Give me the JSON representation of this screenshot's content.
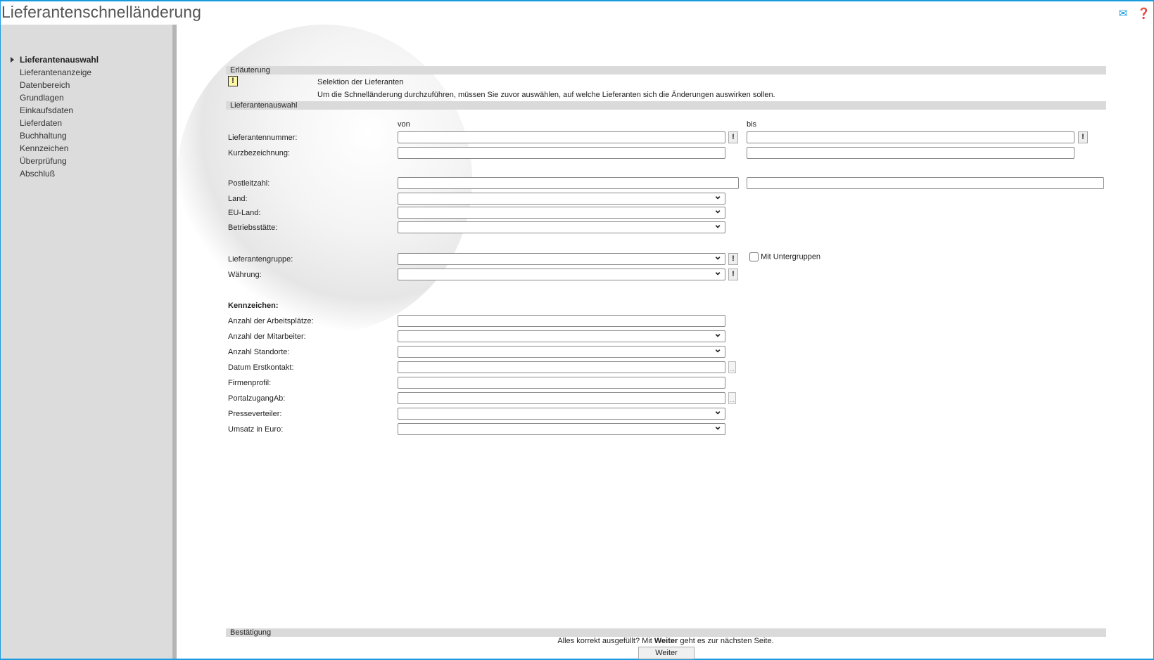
{
  "title": "Lieferantenschnelländerung",
  "header_icons": [
    "mail-icon",
    "help-icon"
  ],
  "sidebar": {
    "items": [
      {
        "label": "Lieferantenauswahl",
        "active": true
      },
      {
        "label": "Lieferantenanzeige"
      },
      {
        "label": "Datenbereich"
      },
      {
        "label": "Grundlagen"
      },
      {
        "label": "Einkaufsdaten"
      },
      {
        "label": "Lieferdaten"
      },
      {
        "label": "Buchhaltung"
      },
      {
        "label": "Kennzeichen"
      },
      {
        "label": "Überprüfung"
      },
      {
        "label": "Abschluß"
      }
    ]
  },
  "explanation": {
    "header": "Erläuterung",
    "title": "Selektion der Lieferanten",
    "text": "Um die Schnelländerung durchzuführen, müssen Sie zuvor auswählen, auf welche Lieferanten sich die Änderungen auswirken sollen."
  },
  "selection": {
    "header": "Lieferantenauswahl",
    "from_label": "von",
    "to_label": "bis",
    "mit_untergruppen": "Mit Untergruppen",
    "kennzeichen_heading": "Kennzeichen:",
    "rows": [
      {
        "label": "Lieferantennummer:",
        "type": "text",
        "to": true,
        "bang": true,
        "value": "",
        "to_value": ""
      },
      {
        "label": "Kurzbezeichnung:",
        "type": "text",
        "to": true,
        "value": "",
        "to_value": ""
      },
      {
        "label": "Postleitzahl:",
        "type": "text",
        "to": true,
        "wide": true,
        "value": "",
        "to_value": ""
      },
      {
        "label": "Land:",
        "type": "select",
        "value": ""
      },
      {
        "label": "EU-Land:",
        "type": "select",
        "value": ""
      },
      {
        "label": "Betriebsstätte:",
        "type": "select",
        "value": ""
      },
      {
        "label": "Lieferantengruppe:",
        "type": "select",
        "bang": true,
        "check": true,
        "value": ""
      },
      {
        "label": "Währung:",
        "type": "select",
        "bang": true,
        "value": ""
      },
      {
        "label": "Anzahl der Arbeitsplätze:",
        "type": "text",
        "value": ""
      },
      {
        "label": "Anzahl der Mitarbeiter:",
        "type": "select",
        "value": ""
      },
      {
        "label": "Anzahl Standorte:",
        "type": "select",
        "value": ""
      },
      {
        "label": "Datum Erstkontakt:",
        "type": "text",
        "dots": true,
        "value": ""
      },
      {
        "label": "Firmenprofil:",
        "type": "text",
        "value": ""
      },
      {
        "label": "PortalzugangAb:",
        "type": "text",
        "dots": true,
        "value": ""
      },
      {
        "label": "Presseverteiler:",
        "type": "select",
        "value": ""
      },
      {
        "label": "Umsatz in Euro:",
        "type": "select",
        "value": ""
      }
    ]
  },
  "confirmation": {
    "header": "Bestätigung",
    "text_pre": "Alles korrekt ausgefüllt?  Mit ",
    "text_bold": "Weiter",
    "text_post": " geht es zur nächsten Seite.",
    "button": "Weiter"
  }
}
